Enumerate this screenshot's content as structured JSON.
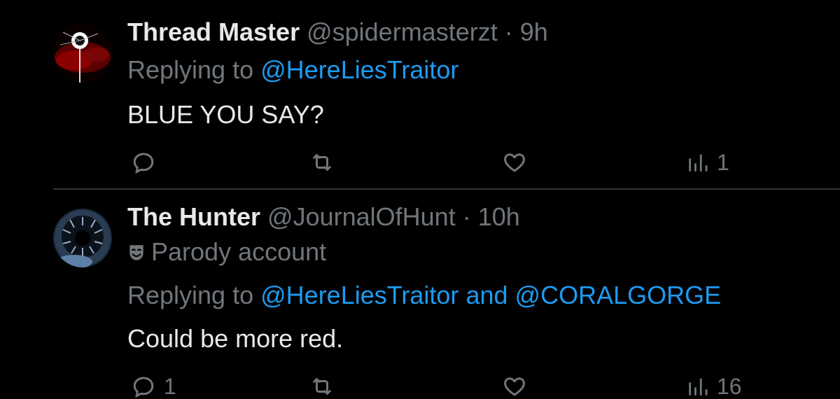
{
  "tweets": [
    {
      "display_name": "Thread Master",
      "handle": "@spidermasterzt",
      "separator": "·",
      "time": "9h",
      "replying_label": "Replying to",
      "replying_to": [
        "@HereLiesTraitor"
      ],
      "replying_joiner": "",
      "body": "BLUE YOU SAY?",
      "reply_count": "",
      "retweet_count": "",
      "like_count": "",
      "view_count": "1"
    },
    {
      "display_name": "The Hunter",
      "handle": "@JournalOfHunt",
      "separator": "·",
      "time": "10h",
      "badge_label": "Parody account",
      "replying_label": "Replying to",
      "replying_to": [
        "@HereLiesTraitor",
        "@CORALGORGE"
      ],
      "replying_joiner": "and",
      "body": "Could be more red.",
      "reply_count": "1",
      "retweet_count": "",
      "like_count": "",
      "view_count": "16"
    }
  ],
  "icons": {
    "reply": "speech-bubble-icon",
    "retweet": "retweet-arrows-icon",
    "like": "heart-icon",
    "views": "bar-chart-icon",
    "parody": "theater-mask-icon"
  },
  "colors": {
    "background": "#000000",
    "primary_text": "#e7e9ea",
    "secondary_text": "#71767b",
    "link": "#1d9bf0",
    "divider": "#2f3336"
  }
}
